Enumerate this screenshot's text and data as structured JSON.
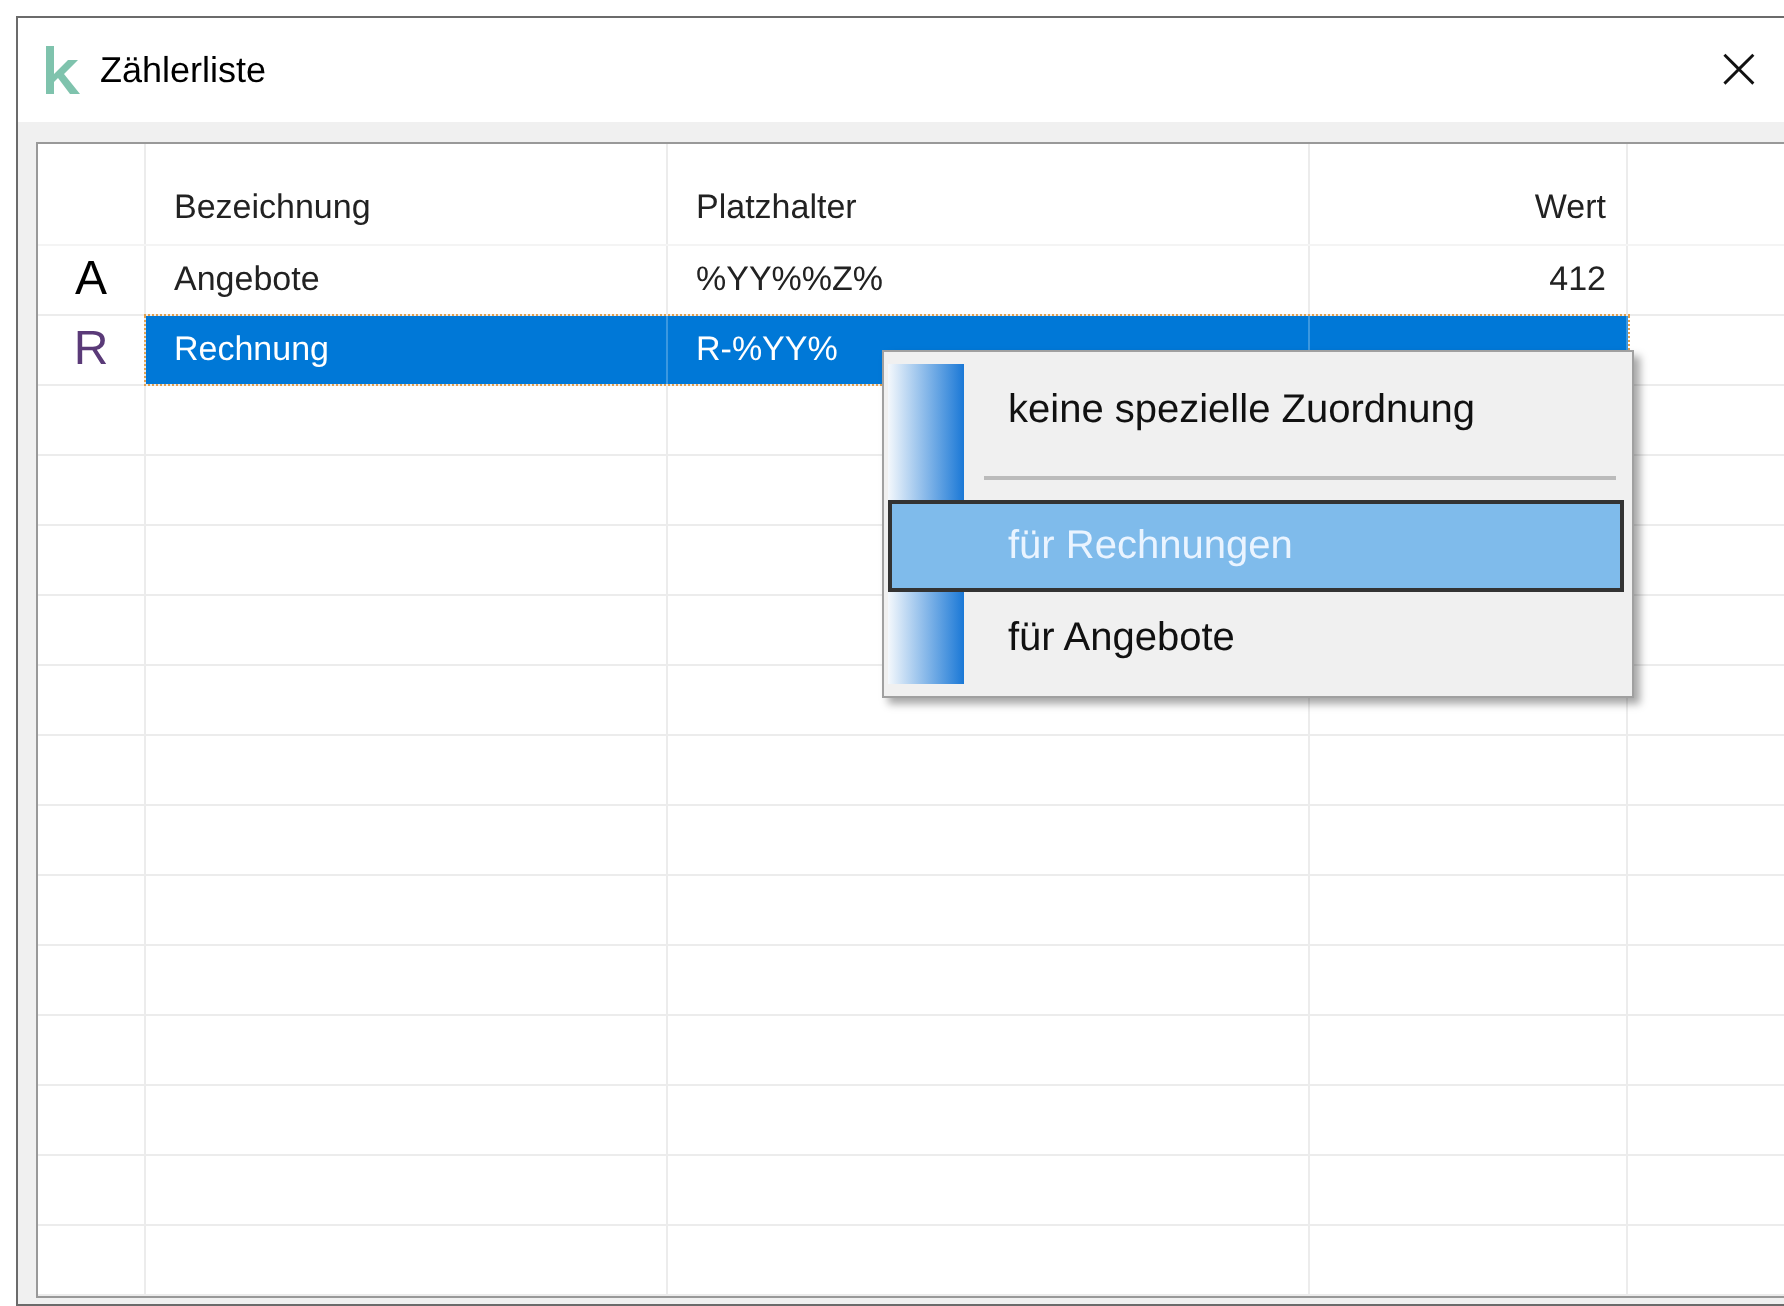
{
  "window": {
    "title": "Zählerliste",
    "close": "×"
  },
  "table": {
    "columns": [
      "Bezeichnung",
      "Platzhalter",
      "Wert"
    ],
    "rows": [
      {
        "letter": "A",
        "color": "#000000",
        "name": "Angebote",
        "placeholder": "%YY%%Z%",
        "value": "412",
        "selected": false
      },
      {
        "letter": "R",
        "color": "#5a3a78",
        "name": "Rechnung",
        "placeholder": "R-%YY%",
        "selected": true
      }
    ]
  },
  "context_menu": {
    "items": [
      {
        "kind": "item",
        "label": "keine spezielle Zuordnung",
        "selected": false
      },
      {
        "kind": "separator"
      },
      {
        "kind": "item",
        "label": "für Rechnungen",
        "selected": true
      },
      {
        "kind": "item",
        "label": "für Angebote",
        "selected": false
      }
    ]
  }
}
